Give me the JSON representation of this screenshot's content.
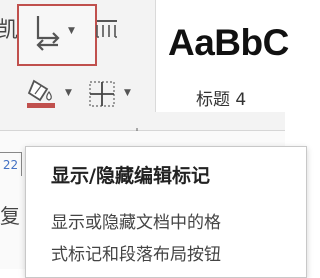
{
  "ribbon": {
    "left_fragment": "凯",
    "buttons": [
      {
        "name": "show-hide-formatting",
        "icon": "show-formatting-marks-icon",
        "has_dropdown": true,
        "highlighted": true
      },
      {
        "name": "column-layout",
        "icon": "columns-icon"
      },
      {
        "name": "shading",
        "icon": "paint-bucket-icon",
        "has_dropdown": true
      },
      {
        "name": "borders",
        "icon": "borders-icon",
        "has_dropdown": true
      }
    ],
    "highlight_color": "#c0504d"
  },
  "styles": {
    "sample_text": "AaBbC",
    "style_name": "标题 4"
  },
  "document": {
    "ruler_number": "22",
    "char": "复"
  },
  "tooltip": {
    "title": "显示/隐藏编辑标记",
    "desc_line1": "显示或隐藏文档中的格",
    "desc_line2": "式标记和段落布局按钮"
  }
}
